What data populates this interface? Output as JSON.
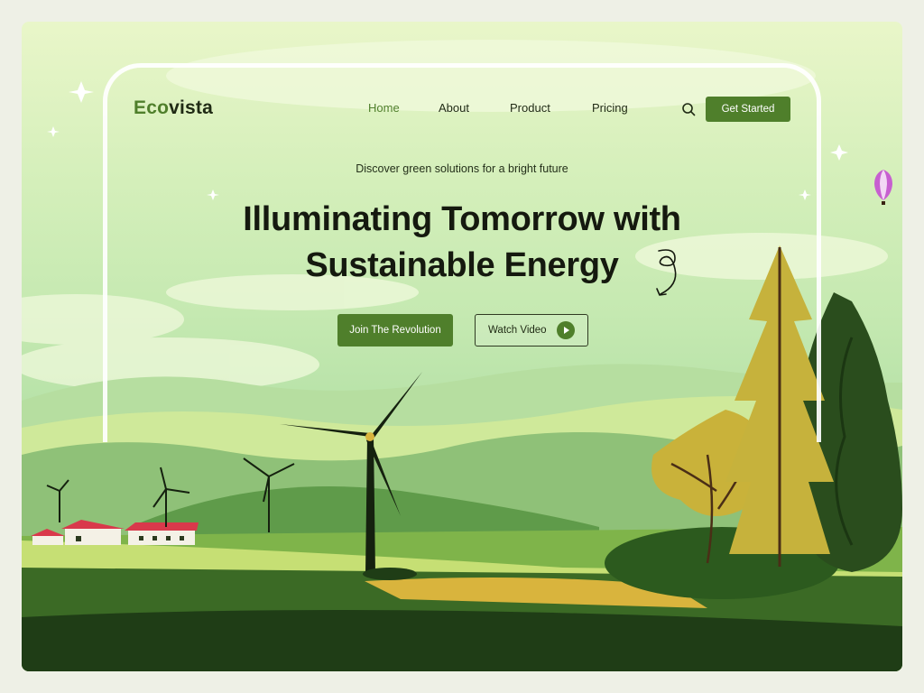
{
  "brand": {
    "part1": "Eco",
    "part2": "vista"
  },
  "nav": {
    "items": [
      "Home",
      "About",
      "Product",
      "Pricing"
    ],
    "active": "Home",
    "cta_label": "Get Started"
  },
  "hero": {
    "tagline": "Discover green solutions for a bright future",
    "headline_line1": "Illuminating Tomorrow with",
    "headline_line2": "Sustainable Energy",
    "primary_button": "Join The Revolution",
    "secondary_button": "Watch Video"
  },
  "icons": [
    "search-icon",
    "play-icon",
    "swirl-arrow-icon",
    "sparkle-icon",
    "hot-air-balloon-icon"
  ],
  "colors": {
    "brand_green": "#4f7f2b",
    "text_dark": "#15190f",
    "sky": "#d4efba",
    "field": "#2f5a1e"
  }
}
